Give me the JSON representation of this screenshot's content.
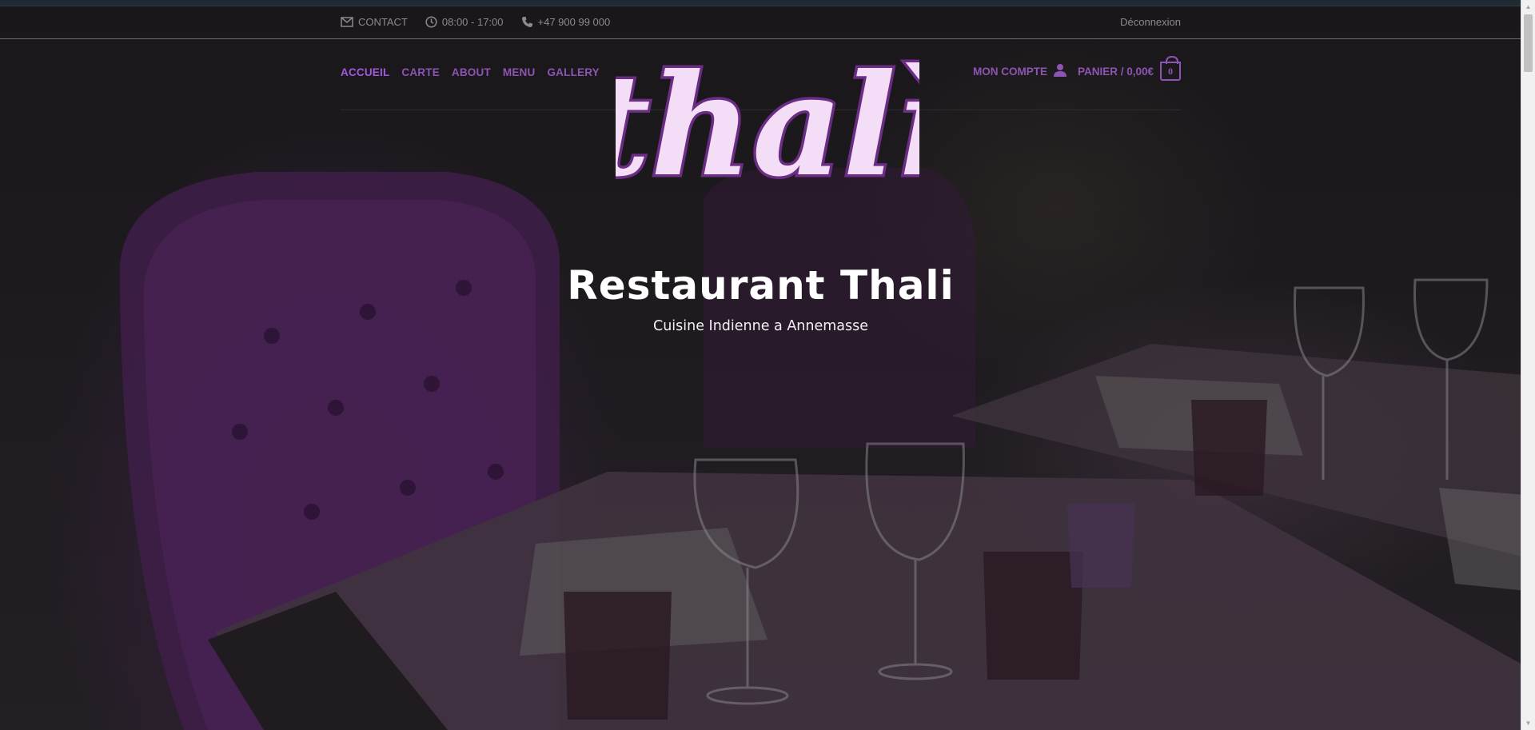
{
  "topbar": {
    "contact_label": "CONTACT",
    "hours": "08:00 - 17:00",
    "phone": "+47 900 99 000",
    "logout_label": "Déconnexion"
  },
  "nav": {
    "items": [
      {
        "label": "ACCUEIL",
        "active": true
      },
      {
        "label": "CARTE",
        "active": false
      },
      {
        "label": "ABOUT",
        "active": false
      },
      {
        "label": "MENU",
        "active": false
      },
      {
        "label": "GALLERY",
        "active": false
      }
    ],
    "account_label": "MON COMPTE",
    "cart_label": "PANIER / 0,00€",
    "cart_count": "0"
  },
  "logo": {
    "text": "thalì"
  },
  "hero": {
    "title": "Restaurant Thali",
    "subtitle": "Cuisine Indienne a Annemasse"
  },
  "icons": {
    "contact": "envelope-icon",
    "hours": "clock-icon",
    "phone": "phone-icon",
    "account": "user-icon",
    "cart": "shopping-bag-icon"
  },
  "colors": {
    "accent": "#a259e0",
    "nav": "#8c55b3",
    "logo_fill": "#f3ddf7",
    "logo_stroke": "#6b2d84"
  }
}
